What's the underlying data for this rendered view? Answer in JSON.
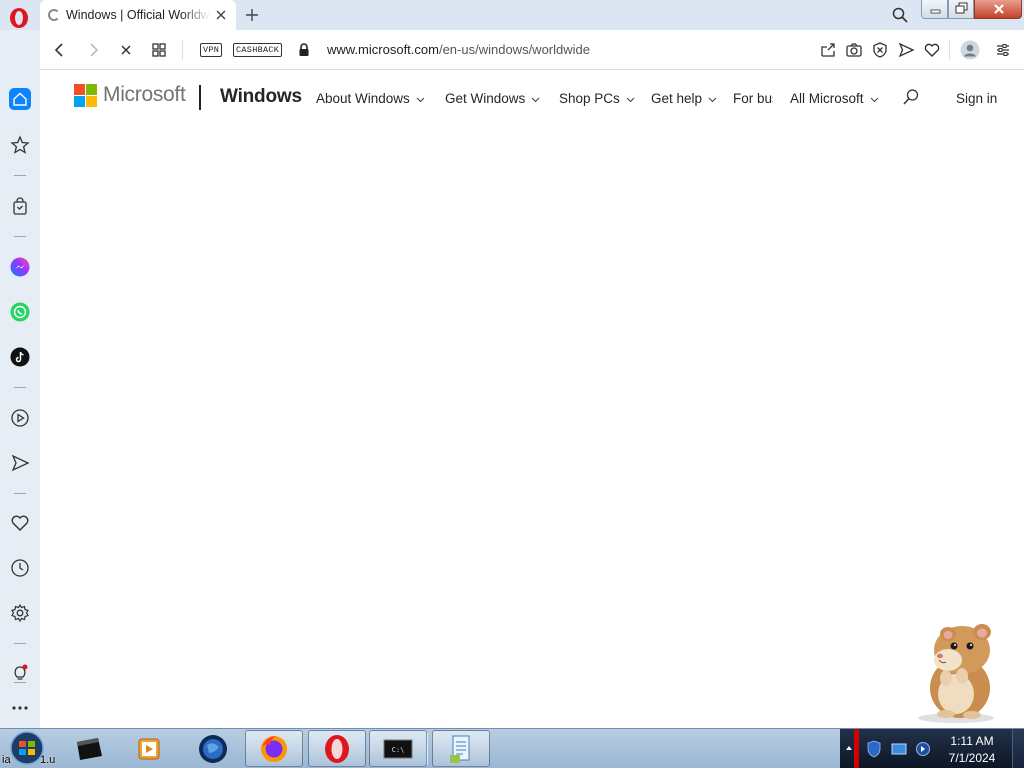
{
  "browser": {
    "tab_title": "Windows | Official Worldwide",
    "url_domain": "www.microsoft.com",
    "url_path": "/en-us/windows/worldwide",
    "vpn_label": "VPN",
    "cashback_label": "CASHBACK"
  },
  "sidebar": {
    "items": [
      "home-icon",
      "star-icon",
      "shopping-bag-icon",
      "messenger-icon",
      "whatsapp-icon",
      "tiktok-icon",
      "player-icon",
      "send-icon",
      "heart-icon",
      "history-icon",
      "settings-icon",
      "lightbulb-icon",
      "more-icon"
    ]
  },
  "header": {
    "brand": "Microsoft",
    "product": "Windows",
    "nav": [
      "About Windows",
      "Get Windows",
      "Shop PCs",
      "Get help",
      "For bus",
      "All Microsoft"
    ],
    "signin": "Sign in"
  },
  "taskbar": {
    "start_label": "ia",
    "start_label_tail": "1.u",
    "apps": [
      "black-square-app-icon",
      "media-player-icon",
      "globe-app-icon",
      "firefox-icon",
      "opera-icon",
      "terminal-icon",
      "notepad-icon"
    ],
    "time": "1:11 AM",
    "date": "7/1/2024"
  },
  "colors": {
    "ms_red": "#f25022",
    "ms_green": "#7fba00",
    "ms_blue": "#00a4ef",
    "ms_yellow": "#ffb900",
    "opera_red": "#e0161f",
    "sidebar_home_active": "#0a84ff"
  }
}
